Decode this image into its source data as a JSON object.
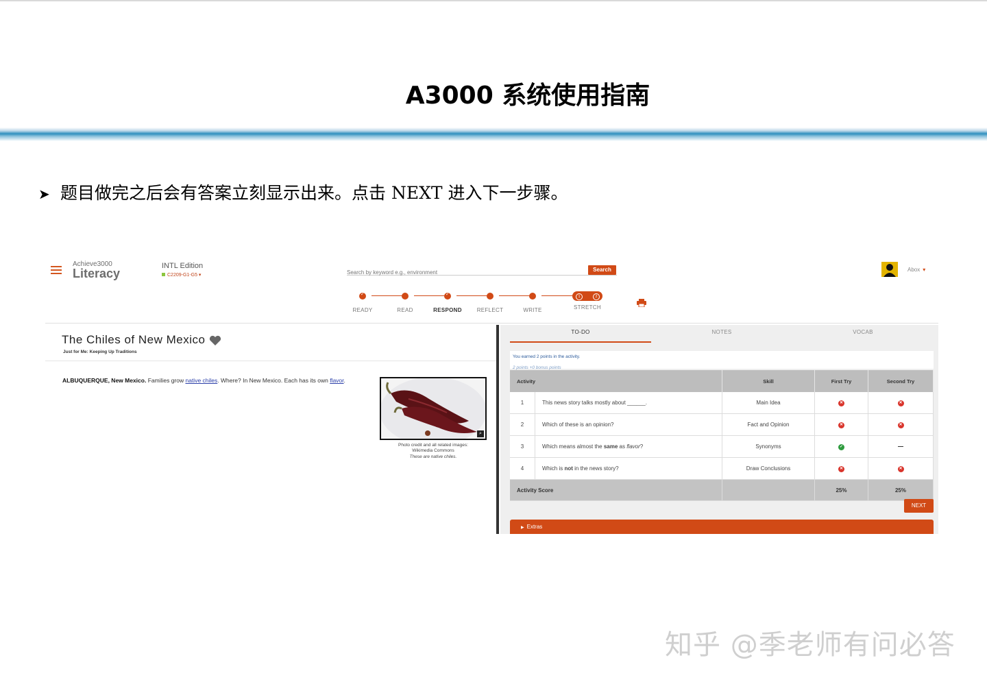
{
  "slide": {
    "title": "A3000  系统使用指南",
    "bullet": "题目做完之后会有答案立刻显示出来。点击 NEXT 进入下一步骤。",
    "watermark": "知乎 @季老师有问必答"
  },
  "app": {
    "logo_top": "Achieve3000",
    "logo_main": "Literacy",
    "edition": "INTL Edition",
    "class_code": "C2209-G1-G5",
    "search_placeholder": "Search by keyword e.g., environment",
    "search_button": "Search",
    "user": "Abox",
    "steps": [
      {
        "label": "READY",
        "state": "done"
      },
      {
        "label": "READ",
        "state": "done"
      },
      {
        "label": "RESPOND",
        "state": "active"
      },
      {
        "label": "REFLECT",
        "state": "todo"
      },
      {
        "label": "WRITE",
        "state": "todo"
      },
      {
        "label": "STRETCH",
        "state": "todo"
      }
    ],
    "stretch_nums": [
      "1",
      "2"
    ]
  },
  "article": {
    "title": "The Chiles of New Mexico",
    "subtitle": "Just for Me: Keeping Up Traditions",
    "dateline": "ALBUQUERQUE, New Mexico.",
    "body_1": " Families grow ",
    "link_1": "native chiles",
    "body_2": ". Where? In New Mexico. Each has its own ",
    "link_2": "flavor",
    "body_3": ".",
    "caption_1": "Photo credit and all related images:",
    "caption_2": "Wikimedia Commons",
    "caption_3": "These are native chiles."
  },
  "panel": {
    "tabs": [
      "TO-DO",
      "NOTES",
      "VOCAB"
    ],
    "earned": "You earned 2 points in the activity.",
    "bonus": "2 points +0 bonus points",
    "headers": [
      "Activity",
      "Skill",
      "First Try",
      "Second Try"
    ],
    "rows": [
      {
        "n": "1",
        "q": "This news story talks mostly about ______.",
        "skill": "Main Idea",
        "first": "wrong",
        "second": "wrong"
      },
      {
        "n": "2",
        "q": "Which of these is an opinion?",
        "skill": "Fact and Opinion",
        "first": "wrong",
        "second": "wrong"
      },
      {
        "n": "3",
        "q": "Which means almost the same as flavor?",
        "skill": "Synonyms",
        "first": "correct",
        "second": "none"
      },
      {
        "n": "4",
        "q": "Which is not in the news story?",
        "skill": "Draw Conclusions",
        "first": "wrong",
        "second": "wrong"
      }
    ],
    "total_label": "Activity Score",
    "total_first": "25%",
    "total_second": "25%",
    "next": "NEXT",
    "extras": "Extras"
  },
  "colors": {
    "accent": "#d14a16",
    "correct": "#2e9b3e",
    "wrong": "#d9342b"
  }
}
